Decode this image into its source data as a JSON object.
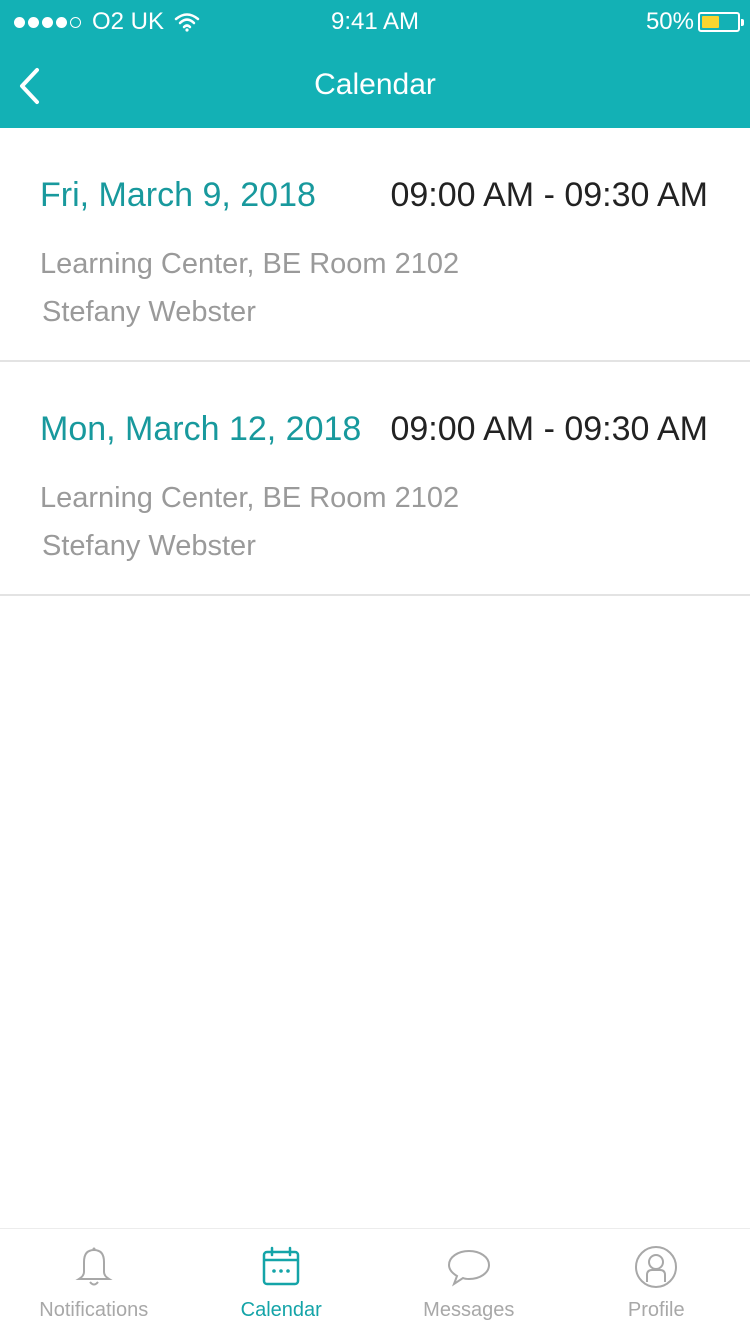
{
  "status_bar": {
    "carrier": "O2 UK",
    "time": "9:41 AM",
    "battery": "50%",
    "battery_level": 0.5,
    "signal_bars_filled": 4,
    "signal_bars_total": 5
  },
  "header": {
    "title": "Calendar",
    "back_icon": "chevron-left-icon"
  },
  "events": [
    {
      "date": "Fri, March 9, 2018",
      "time": "09:00 AM - 09:30 AM",
      "location": "Learning Center, BE Room 2102",
      "person": "Stefany Webster"
    },
    {
      "date": "Mon, March 12, 2018",
      "time": "09:00 AM - 09:30 AM",
      "location": "Learning Center, BE Room 2102",
      "person": "Stefany Webster"
    }
  ],
  "tabbar": {
    "items": [
      {
        "label": "Notifications",
        "icon": "bell-icon",
        "active": false
      },
      {
        "label": "Calendar",
        "icon": "calendar-icon",
        "active": true
      },
      {
        "label": "Messages",
        "icon": "chat-bubble-icon",
        "active": false
      },
      {
        "label": "Profile",
        "icon": "user-icon",
        "active": false
      }
    ]
  },
  "colors": {
    "accent": "#13b1b5",
    "date_text": "#18999d",
    "battery": "#f8d52f",
    "inactive": "#a8a8a8"
  }
}
